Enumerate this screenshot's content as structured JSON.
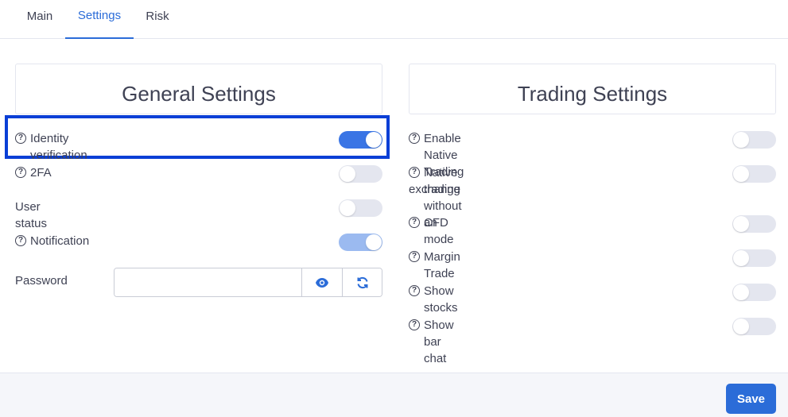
{
  "tabs": [
    {
      "label": "Main"
    },
    {
      "label": "Settings"
    },
    {
      "label": "Risk"
    }
  ],
  "general": {
    "title": "General Settings",
    "items": [
      {
        "label": "Identity verification",
        "help": true,
        "enabled": true
      },
      {
        "label": "2FA",
        "help": true,
        "enabled": false
      },
      {
        "label": "User status",
        "help": false,
        "enabled": false
      },
      {
        "label": "Notification",
        "help": true,
        "enabled": true,
        "disabled": true
      }
    ],
    "password": {
      "label": "Password",
      "value": ""
    }
  },
  "trading": {
    "title": "Trading Settings",
    "items": [
      {
        "label": "Enable Native Trading",
        "help": true,
        "enabled": false
      },
      {
        "label": "Native trading without an",
        "label2": "exchange",
        "help": true,
        "enabled": false
      },
      {
        "label": "CFD mode",
        "help": true,
        "enabled": false
      },
      {
        "label": "Margin Trade",
        "help": true,
        "enabled": false
      },
      {
        "label": "Show stocks",
        "help": true,
        "enabled": false
      },
      {
        "label": "Show bar chat",
        "help": true,
        "enabled": false
      }
    ]
  },
  "footer": {
    "save_label": "Save"
  },
  "icons": {
    "help": "help-circle-icon",
    "eye": "eye-icon",
    "refresh": "refresh-icon"
  },
  "colors": {
    "accent": "#2b6cd8",
    "toggle_on": "#3a75e5",
    "highlight": "#0a3fd6"
  }
}
